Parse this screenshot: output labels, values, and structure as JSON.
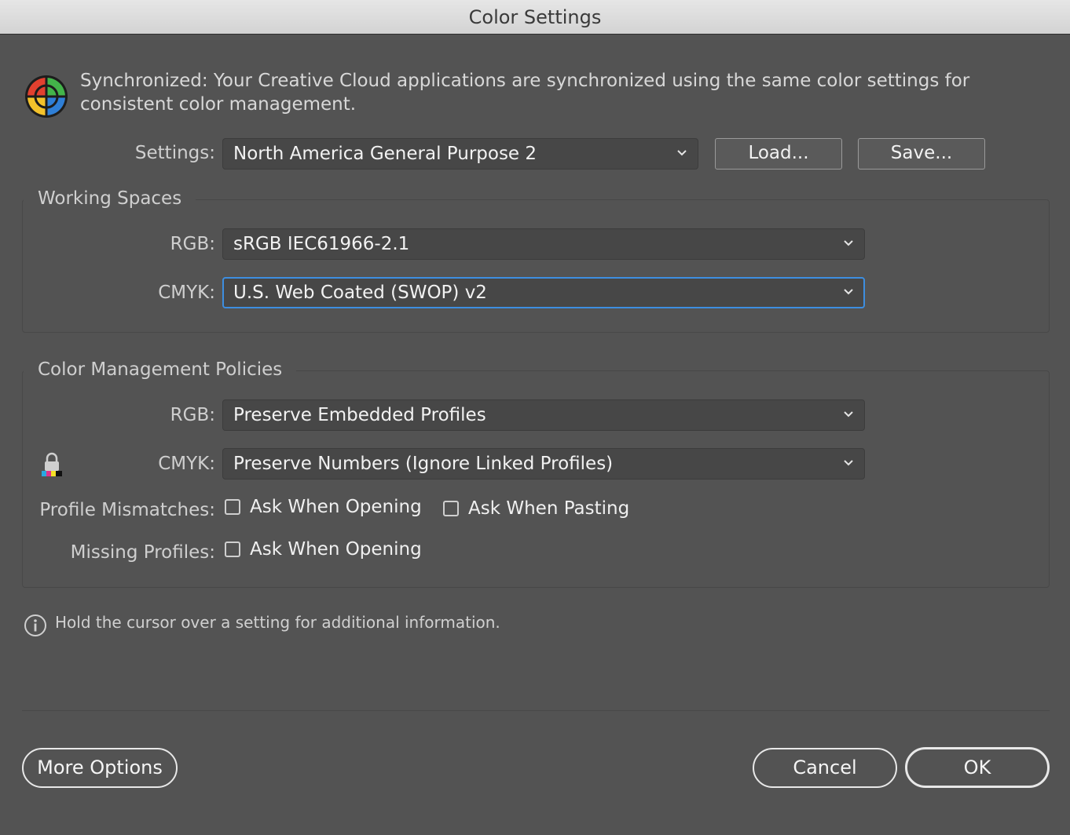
{
  "window": {
    "title": "Color Settings"
  },
  "sync": {
    "message": "Synchronized: Your Creative Cloud applications are synchronized using the same color settings for consistent color management."
  },
  "settings": {
    "label": "Settings:",
    "value": "North America General Purpose 2",
    "load_label": "Load...",
    "save_label": "Save..."
  },
  "working_spaces": {
    "title": "Working Spaces",
    "rgb_label": "RGB:",
    "rgb_value": "sRGB IEC61966-2.1",
    "cmyk_label": "CMYK:",
    "cmyk_value": "U.S. Web Coated (SWOP) v2"
  },
  "policies": {
    "title": "Color Management Policies",
    "rgb_label": "RGB:",
    "rgb_value": "Preserve Embedded Profiles",
    "cmyk_label": "CMYK:",
    "cmyk_value": "Preserve Numbers (Ignore Linked Profiles)",
    "mismatch_label": "Profile Mismatches:",
    "mismatch_opening": "Ask When Opening",
    "mismatch_pasting": "Ask When Pasting",
    "missing_label": "Missing Profiles:",
    "missing_opening": "Ask When Opening",
    "checked": {
      "mismatch_opening": false,
      "mismatch_pasting": false,
      "missing_opening": false
    }
  },
  "info": {
    "text": "Hold the cursor over a setting for additional information."
  },
  "footer": {
    "more_options": "More Options",
    "cancel": "Cancel",
    "ok": "OK"
  },
  "icons": {
    "sync": "color-wheel-icon",
    "lock": "lock-icon",
    "info": "info-icon",
    "chevron": "chevron-down-icon"
  },
  "colors": {
    "background": "#535353",
    "focus_ring": "#3d8ee0"
  }
}
